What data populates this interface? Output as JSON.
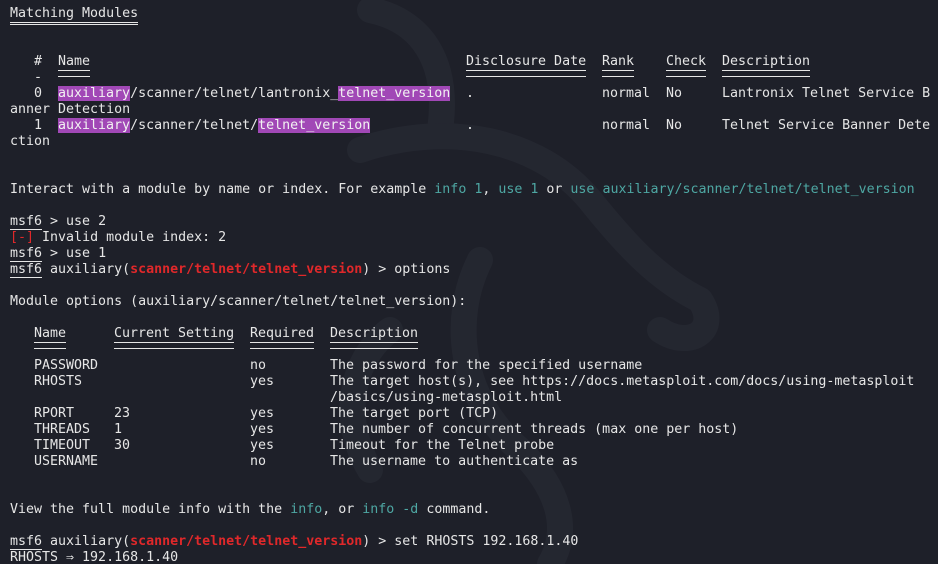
{
  "search": {
    "heading": "Matching Modules",
    "columns": [
      "#",
      "Name",
      "Disclosure Date",
      "Rank",
      "Check",
      "Description"
    ],
    "index_dash": "-",
    "rows": [
      {
        "index": "0",
        "name_hl1": "auxiliary",
        "name_mid": "/scanner/telnet/lantronix_",
        "name_hl2": "telnet_version",
        "date": ".",
        "rank": "normal",
        "check": "No",
        "desc_part1": "Lantronix Telnet Service B",
        "desc_part2": "anner Detection"
      },
      {
        "index": "1",
        "name_hl1": "auxiliary",
        "name_mid": "/scanner/telnet/",
        "name_hl2": "telnet_version",
        "date": ".",
        "rank": "normal",
        "check": "No",
        "desc_part1": "Telnet Service Banner Dete",
        "desc_part2": "ction"
      }
    ]
  },
  "hint": {
    "text1": "Interact with a module by name or index. For example ",
    "ex1": "info 1",
    "sep1": ", ",
    "ex2": "use 1",
    "sep2": " or ",
    "ex3": "use auxiliary/scanner/telnet/telnet_version"
  },
  "prompt": {
    "name": "msf6",
    "module_prefix": " auxiliary(",
    "module_path": "scanner/telnet/telnet_version",
    "module_suffix": ") "
  },
  "commands": [
    " > use 2",
    " > use 1",
    "> options",
    "> set RHOSTS 192.168.1.40"
  ],
  "error": {
    "marker": "[-]",
    "message": " Invalid module index: 2"
  },
  "options": {
    "heading": "Module options (auxiliary/scanner/telnet/telnet_version):",
    "columns": [
      "Name",
      "Current Setting",
      "Required",
      "Description"
    ],
    "rows": [
      {
        "name": "PASSWORD",
        "setting": "",
        "required": "no",
        "description": "The password for the specified username"
      },
      {
        "name": "RHOSTS",
        "setting": "",
        "required": "yes",
        "description": "The target host(s), see https://docs.metasploit.com/docs/using-metasploit",
        "description_wrap": "/basics/using-metasploit.html"
      },
      {
        "name": "RPORT",
        "setting": "23",
        "required": "yes",
        "description": "The target port (TCP)"
      },
      {
        "name": "THREADS",
        "setting": "1",
        "required": "yes",
        "description": "The number of concurrent threads (max one per host)"
      },
      {
        "name": "TIMEOUT",
        "setting": "30",
        "required": "yes",
        "description": "Timeout for the Telnet probe"
      },
      {
        "name": "USERNAME",
        "setting": "",
        "required": "no",
        "description": "The username to authenticate as"
      }
    ]
  },
  "info_hint": {
    "text1": "View the full module info with the ",
    "cmd1": "info",
    "text2": ", or ",
    "cmd2": "info -d",
    "text3": " command."
  },
  "output": {
    "rhosts": "RHOSTS ⇒ 192.168.1.40"
  },
  "colors": {
    "background": "#1e2029",
    "text": "#e6e6e6",
    "highlight": "#a148b6",
    "teal": "#4ea7a3",
    "red": "#e0282a"
  }
}
